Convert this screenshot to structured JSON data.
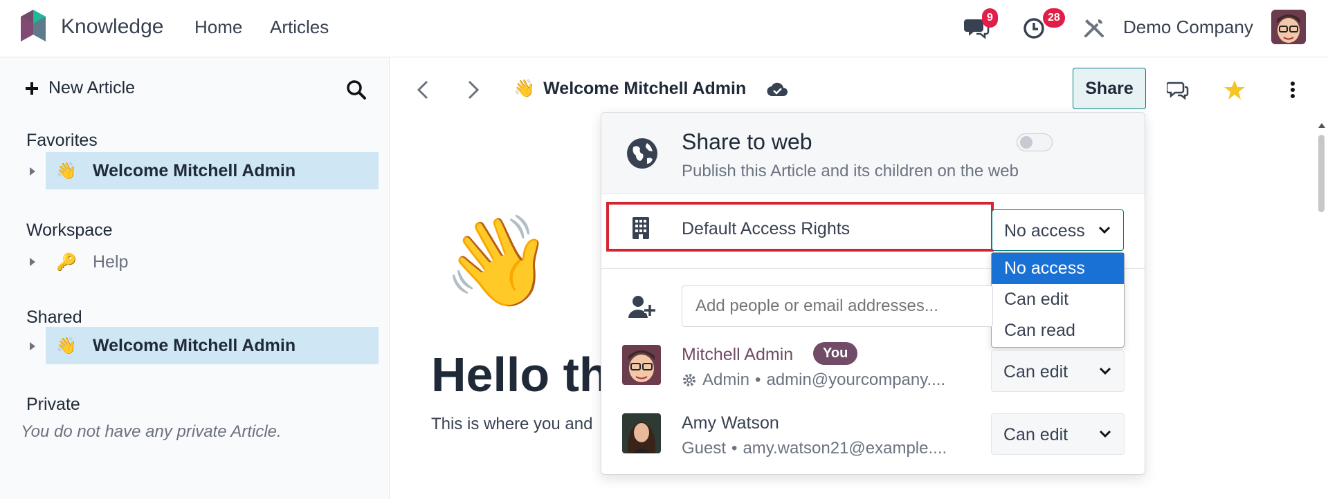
{
  "navbar": {
    "app_name": "Knowledge",
    "links": [
      "Home",
      "Articles"
    ],
    "messages_badge": "9",
    "activities_badge": "28",
    "company": "Demo Company",
    "brand_color": "#714b67"
  },
  "sidebar": {
    "new_article": "New Article",
    "sections": {
      "favorites": {
        "title": "Favorites",
        "item": {
          "emoji": "👋",
          "label": "Welcome Mitchell Admin"
        }
      },
      "workspace": {
        "title": "Workspace",
        "item": {
          "emoji": "🔑",
          "label": "Help"
        }
      },
      "shared": {
        "title": "Shared",
        "item": {
          "emoji": "👋",
          "label": "Welcome Mitchell Admin"
        }
      },
      "private": {
        "title": "Private",
        "empty": "You do not have any private Article."
      }
    }
  },
  "header": {
    "article_emoji": "👋",
    "article_title": "Welcome Mitchell Admin",
    "share_label": "Share"
  },
  "content": {
    "emoji": "👋",
    "heading": "Hello th",
    "text": "This is where you and"
  },
  "share_panel": {
    "web_title": "Share to web",
    "web_subtitle": "Publish this Article and its children on the web",
    "web_enabled": false,
    "default_access_label": "Default Access Rights",
    "default_access_value": "No access",
    "dropdown_options": [
      "No access",
      "Can edit",
      "Can read"
    ],
    "selected_option": "No access",
    "invite_placeholder": "Add people or email addresses...",
    "members": [
      {
        "name": "Mitchell Admin",
        "badge": "You",
        "role": "Admin",
        "email": "admin@yourcompany....",
        "permission": "Can edit"
      },
      {
        "name": "Amy Watson",
        "role": "Guest",
        "email": "amy.watson21@example....",
        "permission": "Can edit"
      }
    ],
    "accent_color": "#017e84",
    "highlight_color": "#d3252f"
  }
}
